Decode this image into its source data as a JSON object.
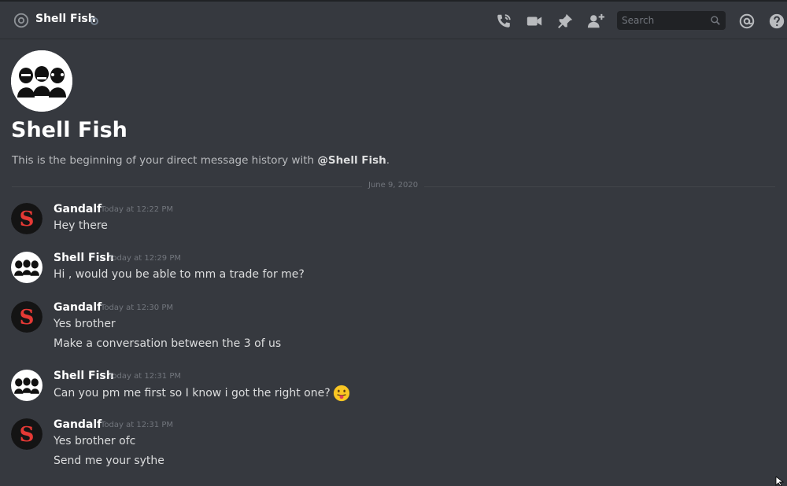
{
  "header": {
    "channel_icon": "at-icon",
    "title": "Shell Fish",
    "status": "offline",
    "search_placeholder": "Search",
    "icons": [
      "call-icon",
      "video-icon",
      "pin-icon",
      "add-friend-icon",
      "mention-icon",
      "help-icon"
    ]
  },
  "intro": {
    "name": "Shell Fish",
    "desc_prefix": "This is the beginning of your direct message history with ",
    "desc_user": "@Shell Fish",
    "desc_suffix": "."
  },
  "date_divider": "June 9, 2020",
  "messages": [
    {
      "author": "Gandalf",
      "timestamp": "Today at 12:22 PM",
      "lines": [
        "Hey there"
      ]
    },
    {
      "author": "Shell Fish",
      "timestamp": "Today at 12:29 PM",
      "lines": [
        "Hi , would you be able to mm a trade for me?"
      ]
    },
    {
      "author": "Gandalf",
      "timestamp": "Today at 12:30 PM",
      "lines": [
        "Yes brother",
        "Make a conversation between the 3 of us"
      ]
    },
    {
      "author": "Shell Fish",
      "timestamp": "Today at 12:31 PM",
      "lines": [
        "Can you pm me first so I know i got the right one?"
      ],
      "emoji": "tongue-out-emoji"
    },
    {
      "author": "Gandalf",
      "timestamp": "Today at 12:31 PM",
      "lines": [
        "Yes brother ofc",
        "Send me your sythe"
      ]
    }
  ],
  "colors": {
    "background": "#36393f",
    "header_text": "#ffffff",
    "text": "#dcddde",
    "muted": "#72767d",
    "gandalf_avatar_red": "#e53935"
  }
}
